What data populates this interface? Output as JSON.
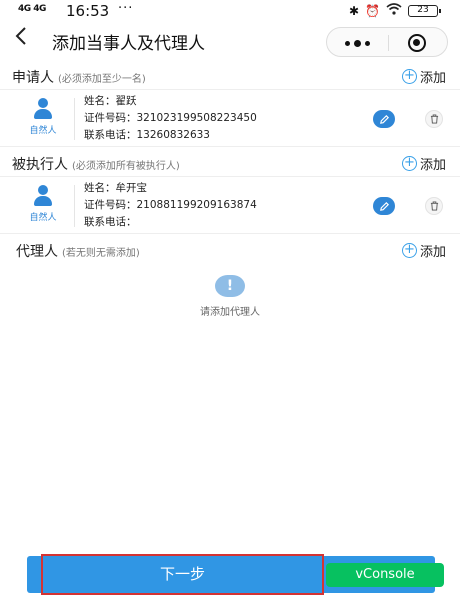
{
  "status_bar": {
    "signal": "4G 4G",
    "time": "16:53",
    "dots": "···",
    "battery": "23"
  },
  "nav": {
    "title": "添加当事人及代理人"
  },
  "applicant": {
    "title": "申请人",
    "note": "(必须添加至少一名)",
    "add_label": "添加",
    "card": {
      "type_label": "自然人",
      "name_label": "姓名：",
      "name": "翟跃",
      "id_label": "证件号码：",
      "id_no": "321023199508223450",
      "phone_label": "联系电话：",
      "phone": "13260832633"
    }
  },
  "respondent": {
    "title": "被执行人",
    "note": "(必须添加所有被执行人)",
    "add_label": "添加",
    "card": {
      "type_label": "自然人",
      "name_label": "姓名：",
      "name": "牟开宝",
      "id_label": "证件号码：",
      "id_no": "210881199209163874",
      "phone_label": "联系电话：",
      "phone": ""
    }
  },
  "agent": {
    "title": "代理人",
    "note": "(若无则无需添加)",
    "add_label": "添加",
    "empty_icon": "!",
    "empty_text": "请添加代理人"
  },
  "footer": {
    "next_label": "下一步",
    "vconsole_label": "vConsole"
  },
  "colors": {
    "primary": "#3096e4",
    "avatar": "#2f86d6",
    "highlight_border": "#d43333",
    "vconsole": "#07c160"
  }
}
